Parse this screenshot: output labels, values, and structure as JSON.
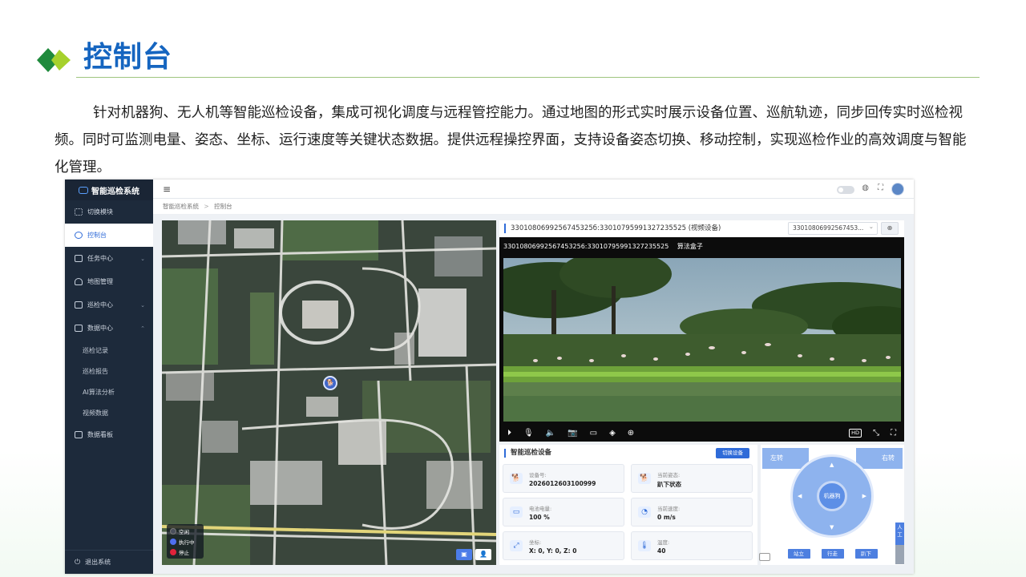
{
  "slide": {
    "title": "控制台",
    "intro": "针对机器狗、无人机等智能巡检设备，集成可视化调度与远程管控能力。通过地图的形式实时展示设备位置、巡航轨迹，同步回传实时巡检视频。同时可监测电量、姿态、坐标、运行速度等关键状态数据。提供远程操控界面，支持设备姿态切换、移动控制，实现巡检作业的高效调度与智能化管理。"
  },
  "app": {
    "brand": "智能巡检系统",
    "sidebar": {
      "items": [
        {
          "label": "切换模块"
        },
        {
          "label": "控制台"
        },
        {
          "label": "任务中心"
        },
        {
          "label": "地图管理"
        },
        {
          "label": "巡检中心"
        },
        {
          "label": "数据中心"
        }
      ],
      "sub_items": [
        {
          "label": "巡检记录"
        },
        {
          "label": "巡检报告"
        },
        {
          "label": "AI算法分析"
        },
        {
          "label": "视频数据"
        }
      ],
      "dashboard": "数据看板",
      "logout": "退出系统"
    },
    "breadcrumb": {
      "root": "智能巡检系统",
      "current": "控制台"
    },
    "map": {
      "legend": [
        {
          "label": "空闲",
          "color": "#4a4f5c"
        },
        {
          "label": "执行中",
          "color": "#4f6ff0"
        },
        {
          "label": "停止",
          "color": "#e0233a"
        }
      ]
    },
    "video": {
      "panel_title": "3301080699256745325б:33010795991327235525 (视频设备)",
      "select_value": "33010806992567453...",
      "stream_label": "33010806992567453256:33010795991327235525",
      "stream_tag": "算法盒子",
      "quality": "HD"
    },
    "device": {
      "title": "智能巡检设备",
      "switch_button": "切换设备",
      "cards": [
        {
          "label": "设备号:",
          "value": "2026012603100999",
          "icon": "robot-dog-icon"
        },
        {
          "label": "当前姿态:",
          "value": "趴下状态",
          "icon": "posture-icon"
        },
        {
          "label": "电池电量:",
          "value": "100 %",
          "icon": "battery-icon"
        },
        {
          "label": "当前速度:",
          "value": "0 m/s",
          "icon": "speedometer-icon"
        },
        {
          "label": "坐标:",
          "value": "X: 0, Y: 0, Z: 0",
          "icon": "coordinate-icon"
        },
        {
          "label": "温度:",
          "value": "40",
          "icon": "thermometer-icon"
        }
      ]
    },
    "control": {
      "turn_left": "左转",
      "turn_right": "右转",
      "center": "机器狗",
      "buttons": [
        "站立",
        "行走",
        "趴下"
      ],
      "side_tab": "人工"
    }
  }
}
